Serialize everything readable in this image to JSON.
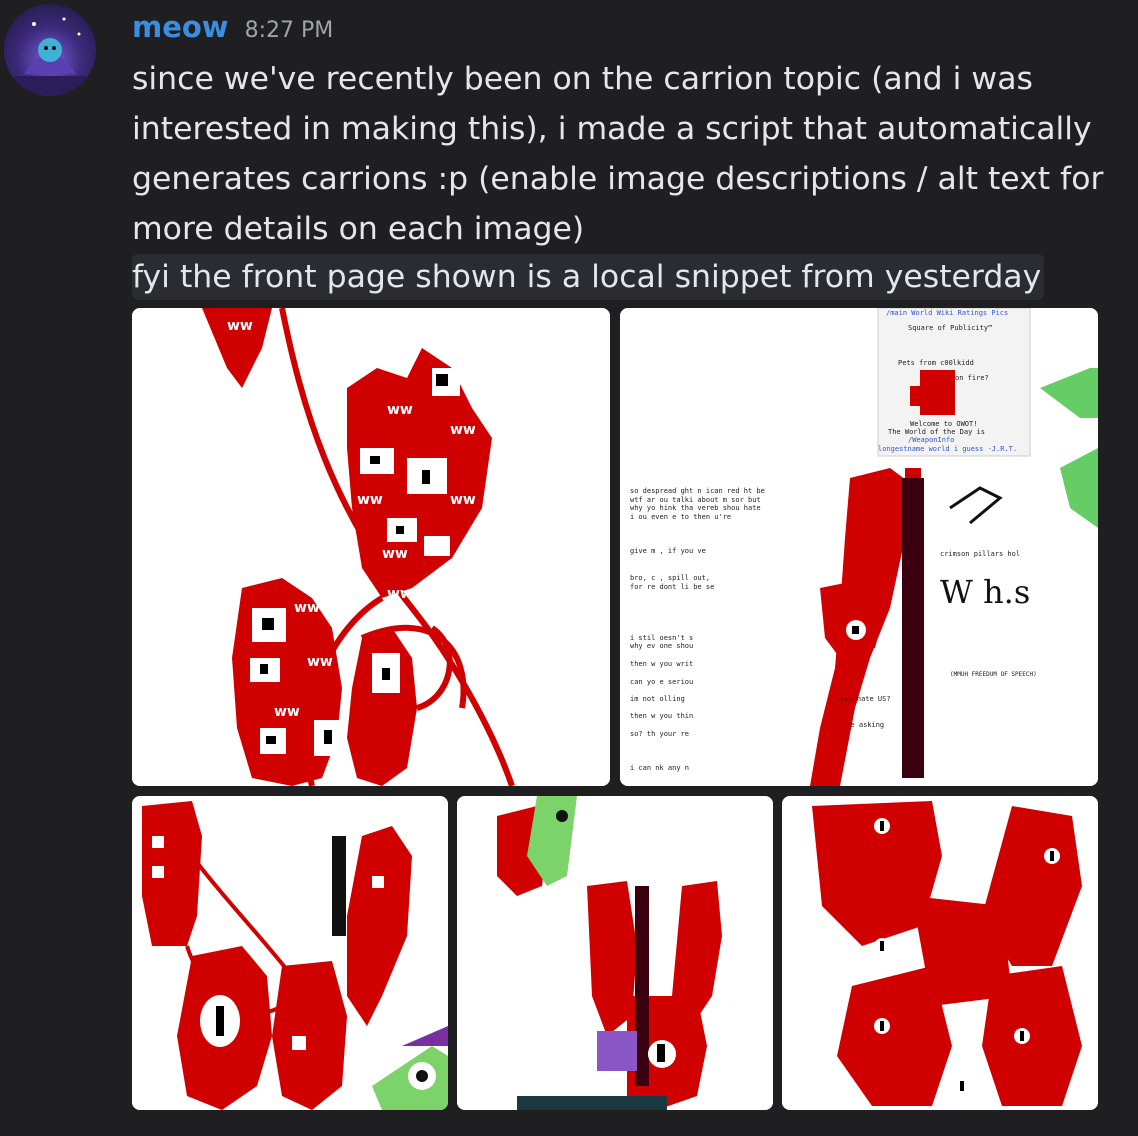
{
  "message": {
    "username": "meow",
    "timestamp": "8:27 PM",
    "text": "since we've recently been on the carrion topic (and i was interested in making this), i made a script that automatically generates carrions :p (enable image descriptions / alt text for more details on each image)",
    "reply_line": "fyi the front page shown is a local snippet from yesterday"
  },
  "images": {
    "count": 5,
    "tile2_header": {
      "nav": "/main World Wiki Ratings Pics",
      "title": "Square of Publicity™",
      "line1": "Pets from c00lkidd",
      "line2": "on fire?",
      "welcome": "Welcome to OWOT!",
      "wotd": "The World of the Day is",
      "weapon": "/WeaponInfo",
      "longest": "longestname world i guess -J.R.T."
    },
    "tile2_text": [
      "crimson pillars hol",
      "(MMUH FREEDUM OF SPEECH)",
      "you hate US?",
      "'re asking"
    ]
  },
  "colors": {
    "background": "#1f1f22",
    "username": "#3a8ee0",
    "carrion_red": "#d00000",
    "text": "#e6e6ea"
  }
}
